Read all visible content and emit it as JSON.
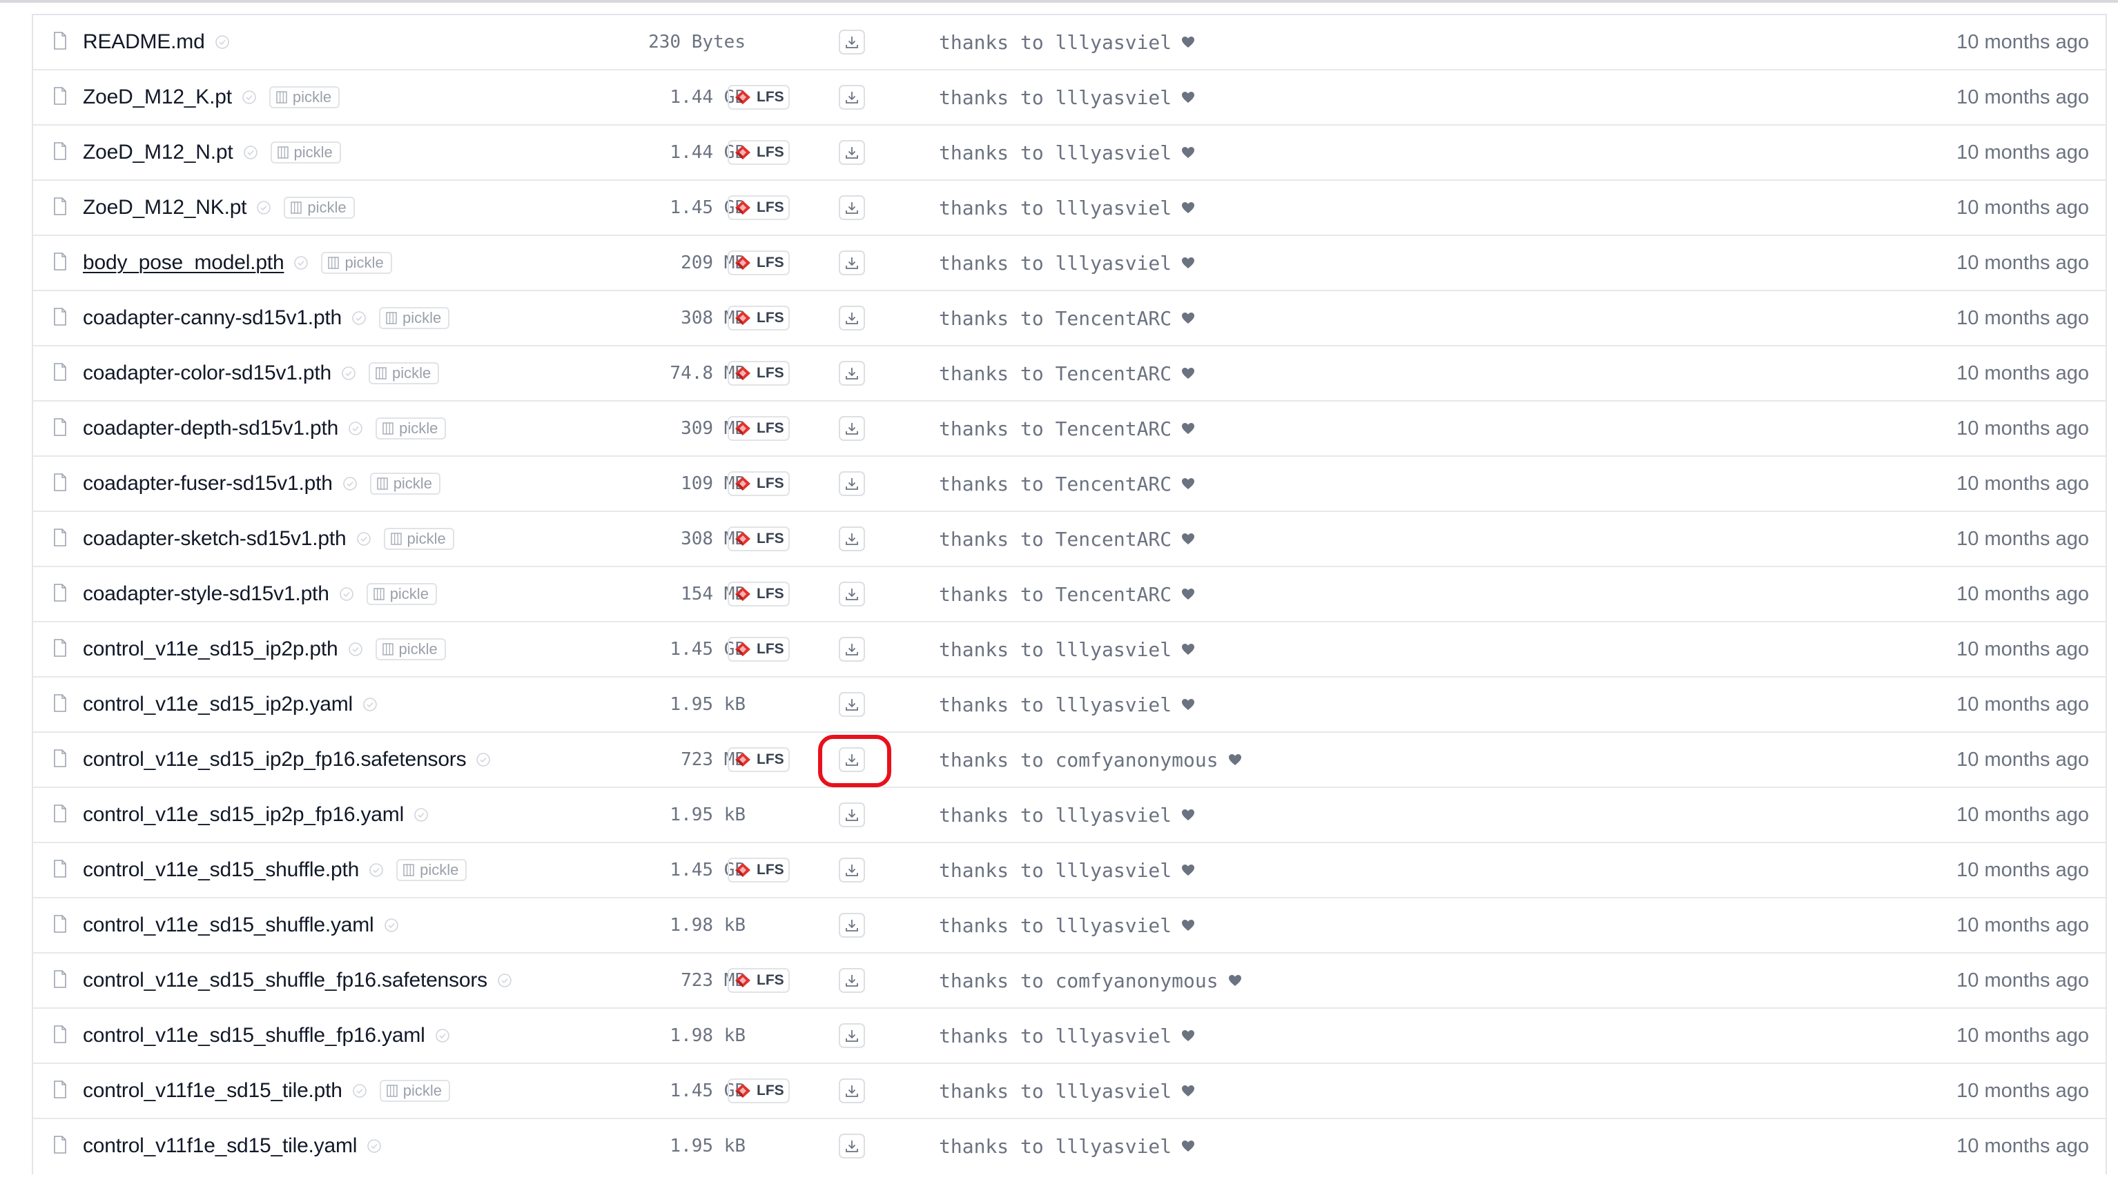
{
  "files": [
    {
      "name": "README.md",
      "size": "230 Bytes",
      "pickle": false,
      "lfs": false,
      "commit": "thanks to lllyasviel",
      "date": "10 months ago",
      "underlined": false,
      "highlighted": false
    },
    {
      "name": "ZoeD_M12_K.pt",
      "size": "1.44 GB",
      "pickle": true,
      "lfs": true,
      "commit": "thanks to lllyasviel",
      "date": "10 months ago",
      "underlined": false,
      "highlighted": false
    },
    {
      "name": "ZoeD_M12_N.pt",
      "size": "1.44 GB",
      "pickle": true,
      "lfs": true,
      "commit": "thanks to lllyasviel",
      "date": "10 months ago",
      "underlined": false,
      "highlighted": false
    },
    {
      "name": "ZoeD_M12_NK.pt",
      "size": "1.45 GB",
      "pickle": true,
      "lfs": true,
      "commit": "thanks to lllyasviel",
      "date": "10 months ago",
      "underlined": false,
      "highlighted": false
    },
    {
      "name": "body_pose_model.pth",
      "size": "209 MB",
      "pickle": true,
      "lfs": true,
      "commit": "thanks to lllyasviel",
      "date": "10 months ago",
      "underlined": true,
      "highlighted": false
    },
    {
      "name": "coadapter-canny-sd15v1.pth",
      "size": "308 MB",
      "pickle": true,
      "lfs": true,
      "commit": "thanks to TencentARC",
      "date": "10 months ago",
      "underlined": false,
      "highlighted": false
    },
    {
      "name": "coadapter-color-sd15v1.pth",
      "size": "74.8 MB",
      "pickle": true,
      "lfs": true,
      "commit": "thanks to TencentARC",
      "date": "10 months ago",
      "underlined": false,
      "highlighted": false
    },
    {
      "name": "coadapter-depth-sd15v1.pth",
      "size": "309 MB",
      "pickle": true,
      "lfs": true,
      "commit": "thanks to TencentARC",
      "date": "10 months ago",
      "underlined": false,
      "highlighted": false
    },
    {
      "name": "coadapter-fuser-sd15v1.pth",
      "size": "109 MB",
      "pickle": true,
      "lfs": true,
      "commit": "thanks to TencentARC",
      "date": "10 months ago",
      "underlined": false,
      "highlighted": false
    },
    {
      "name": "coadapter-sketch-sd15v1.pth",
      "size": "308 MB",
      "pickle": true,
      "lfs": true,
      "commit": "thanks to TencentARC",
      "date": "10 months ago",
      "underlined": false,
      "highlighted": false
    },
    {
      "name": "coadapter-style-sd15v1.pth",
      "size": "154 MB",
      "pickle": true,
      "lfs": true,
      "commit": "thanks to TencentARC",
      "date": "10 months ago",
      "underlined": false,
      "highlighted": false
    },
    {
      "name": "control_v11e_sd15_ip2p.pth",
      "size": "1.45 GB",
      "pickle": true,
      "lfs": true,
      "commit": "thanks to lllyasviel",
      "date": "10 months ago",
      "underlined": false,
      "highlighted": false
    },
    {
      "name": "control_v11e_sd15_ip2p.yaml",
      "size": "1.95 kB",
      "pickle": false,
      "lfs": false,
      "commit": "thanks to lllyasviel",
      "date": "10 months ago",
      "underlined": false,
      "highlighted": false
    },
    {
      "name": "control_v11e_sd15_ip2p_fp16.safetensors",
      "size": "723 MB",
      "pickle": false,
      "lfs": true,
      "commit": "thanks to comfyanonymous",
      "date": "10 months ago",
      "underlined": false,
      "highlighted": true
    },
    {
      "name": "control_v11e_sd15_ip2p_fp16.yaml",
      "size": "1.95 kB",
      "pickle": false,
      "lfs": false,
      "commit": "thanks to lllyasviel",
      "date": "10 months ago",
      "underlined": false,
      "highlighted": false
    },
    {
      "name": "control_v11e_sd15_shuffle.pth",
      "size": "1.45 GB",
      "pickle": true,
      "lfs": true,
      "commit": "thanks to lllyasviel",
      "date": "10 months ago",
      "underlined": false,
      "highlighted": false
    },
    {
      "name": "control_v11e_sd15_shuffle.yaml",
      "size": "1.98 kB",
      "pickle": false,
      "lfs": false,
      "commit": "thanks to lllyasviel",
      "date": "10 months ago",
      "underlined": false,
      "highlighted": false
    },
    {
      "name": "control_v11e_sd15_shuffle_fp16.safetensors",
      "size": "723 MB",
      "pickle": false,
      "lfs": true,
      "commit": "thanks to comfyanonymous",
      "date": "10 months ago",
      "underlined": false,
      "highlighted": false
    },
    {
      "name": "control_v11e_sd15_shuffle_fp16.yaml",
      "size": "1.98 kB",
      "pickle": false,
      "lfs": false,
      "commit": "thanks to lllyasviel",
      "date": "10 months ago",
      "underlined": false,
      "highlighted": false
    },
    {
      "name": "control_v11f1e_sd15_tile.pth",
      "size": "1.45 GB",
      "pickle": true,
      "lfs": true,
      "commit": "thanks to lllyasviel",
      "date": "10 months ago",
      "underlined": false,
      "highlighted": false
    },
    {
      "name": "control_v11f1e_sd15_tile.yaml",
      "size": "1.95 kB",
      "pickle": false,
      "lfs": false,
      "commit": "thanks to lllyasviel",
      "date": "10 months ago",
      "underlined": false,
      "highlighted": false
    }
  ],
  "labels": {
    "pickle_badge": "pickle",
    "lfs_badge": "LFS"
  },
  "icons": {
    "file": "file-icon",
    "safe": "shield-check-icon",
    "pickle": "pickle-grid-icon",
    "lfs": "lfs-logo-icon",
    "download": "download-icon",
    "heart": "heart-icon"
  },
  "colors": {
    "lfs_red": "#e0322f",
    "highlight_ring": "#e8111b",
    "text_primary": "#111827",
    "text_muted": "#6b7280"
  }
}
